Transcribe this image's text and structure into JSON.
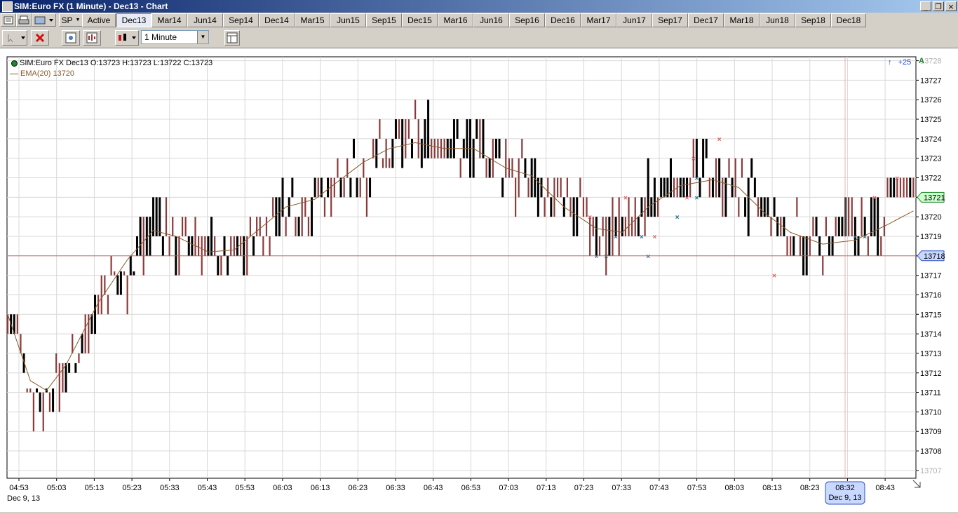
{
  "window": {
    "title": "SIM:Euro FX (1 Minute) - Dec13 - Chart"
  },
  "tabbar": {
    "instrument": "SP",
    "active_label": "Active",
    "tabs": [
      "Dec13",
      "Mar14",
      "Jun14",
      "Sep14",
      "Dec14",
      "Mar15",
      "Jun15",
      "Sep15",
      "Dec15",
      "Mar16",
      "Jun16",
      "Sep16",
      "Dec16",
      "Mar17",
      "Jun17",
      "Sep17",
      "Dec17",
      "Mar18",
      "Jun18",
      "Sep18",
      "Dec18"
    ],
    "selected_tab": "Dec13"
  },
  "toolbar": {
    "interval_value": "1 Minute"
  },
  "chart_header": {
    "series_label": "SIM:Euro FX Dec13 O:13723 H:13723 L:13722 C:13723",
    "indicator_label": "EMA(20)  13720",
    "scroll_label": "+25",
    "axis_flag": "A"
  },
  "colors": {
    "up_bar": "#000000",
    "down_bar": "#8b3a3a",
    "ema": "#8b5a2b",
    "grid": "#d8d8d8",
    "buy_marker": "#1f6f8b",
    "sell_marker": "#e05a5a",
    "last_price_bg": "#ccffcc",
    "crosshair_bg": "#c8d8ff"
  },
  "chart_data": {
    "type": "bar",
    "ylim": [
      13706.6,
      13728.2
    ],
    "y_ticks": [
      13707,
      13708,
      13709,
      13710,
      13711,
      13712,
      13713,
      13714,
      13715,
      13716,
      13717,
      13718,
      13719,
      13720,
      13721,
      13722,
      13723,
      13724,
      13725,
      13726,
      13727,
      13728
    ],
    "x_ticks": [
      "04:53",
      "05:03",
      "05:13",
      "05:23",
      "05:33",
      "05:43",
      "05:53",
      "06:03",
      "06:13",
      "06:23",
      "06:33",
      "06:43",
      "06:53",
      "07:03",
      "07:13",
      "07:23",
      "07:33",
      "07:43",
      "07:53",
      "08:03",
      "08:13",
      "08:23",
      "08:33",
      "08:43"
    ],
    "date_label": "Dec 9, 13",
    "last_price": "13721",
    "crosshair_price": "13718",
    "crosshair_time": "08:32",
    "crosshair_date": "Dec 9, 13",
    "ema_anchors": [
      [
        0,
        13715
      ],
      [
        7,
        13711.6
      ],
      [
        12,
        13711.1
      ],
      [
        18,
        13712.4
      ],
      [
        28,
        13715.6
      ],
      [
        37,
        13717.8
      ],
      [
        45,
        13719.3
      ],
      [
        52,
        13719
      ],
      [
        62,
        13718.2
      ],
      [
        70,
        13718.3
      ],
      [
        78,
        13719.4
      ],
      [
        86,
        13720.5
      ],
      [
        95,
        13720.9
      ],
      [
        102,
        13721.8
      ],
      [
        110,
        13722.8
      ],
      [
        118,
        13723.5
      ],
      [
        126,
        13723.8
      ],
      [
        135,
        13723.5
      ],
      [
        144,
        13723.5
      ],
      [
        154,
        13722.5
      ],
      [
        162,
        13722.1
      ],
      [
        172,
        13720.5
      ],
      [
        182,
        13719.4
      ],
      [
        190,
        13719.2
      ],
      [
        198,
        13720.5
      ],
      [
        208,
        13721.6
      ],
      [
        218,
        13721.9
      ],
      [
        226,
        13721.5
      ],
      [
        234,
        13720.2
      ],
      [
        242,
        13719.2
      ],
      [
        252,
        13718.6
      ],
      [
        262,
        13718.8
      ],
      [
        272,
        13719.6
      ],
      [
        280,
        13720.3
      ]
    ],
    "bar_segments": [
      {
        "from": 0,
        "to": 16,
        "lo": 13708,
        "hi": 13711.2
      },
      {
        "from": 16,
        "to": 22,
        "lo": 13710,
        "hi": 13712.5
      },
      {
        "from": 22,
        "to": 40,
        "lo": 13712.5,
        "hi": 13717.2
      },
      {
        "from": 40,
        "to": 55,
        "lo": 13716.5,
        "hi": 13723
      },
      {
        "from": 55,
        "to": 66,
        "lo": 13717,
        "hi": 13720
      },
      {
        "from": 66,
        "to": 82,
        "lo": 13717,
        "hi": 13719
      },
      {
        "from": 82,
        "to": 100,
        "lo": 13719,
        "hi": 13724.9
      },
      {
        "from": 100,
        "to": 114,
        "lo": 13720,
        "hi": 13722
      },
      {
        "from": 114,
        "to": 130,
        "lo": 13722.5,
        "hi": 13725
      },
      {
        "from": 130,
        "to": 138,
        "lo": 13723,
        "hi": 13727
      },
      {
        "from": 138,
        "to": 152,
        "lo": 13722,
        "hi": 13725.5
      },
      {
        "from": 152,
        "to": 164,
        "lo": 13720,
        "hi": 13724
      },
      {
        "from": 164,
        "to": 176,
        "lo": 13718,
        "hi": 13722
      },
      {
        "from": 176,
        "to": 190,
        "lo": 13716,
        "hi": 13721
      },
      {
        "from": 190,
        "to": 202,
        "lo": 13719,
        "hi": 13726
      },
      {
        "from": 202,
        "to": 220,
        "lo": 13721,
        "hi": 13725
      },
      {
        "from": 220,
        "to": 232,
        "lo": 13719,
        "hi": 13723
      },
      {
        "from": 232,
        "to": 256,
        "lo": 13715,
        "hi": 13719
      },
      {
        "from": 256,
        "to": 272,
        "lo": 13718,
        "hi": 13721
      },
      {
        "from": 272,
        "to": 281,
        "lo": 13721,
        "hi": 13723
      }
    ],
    "buy_markers": [
      [
        182,
        13718
      ],
      [
        185,
        13718
      ],
      [
        188,
        13719
      ],
      [
        196,
        13719
      ],
      [
        198,
        13718
      ],
      [
        207,
        13720
      ],
      [
        213,
        13722
      ],
      [
        213,
        13721
      ],
      [
        262,
        13719
      ],
      [
        265,
        13719
      ]
    ],
    "sell_markers": [
      [
        180,
        13720
      ],
      [
        191,
        13721
      ],
      [
        200,
        13719
      ],
      [
        210,
        13721
      ],
      [
        212,
        13723
      ],
      [
        220,
        13724
      ],
      [
        237,
        13717
      ],
      [
        268,
        13721
      ],
      [
        275,
        13722
      ]
    ]
  }
}
